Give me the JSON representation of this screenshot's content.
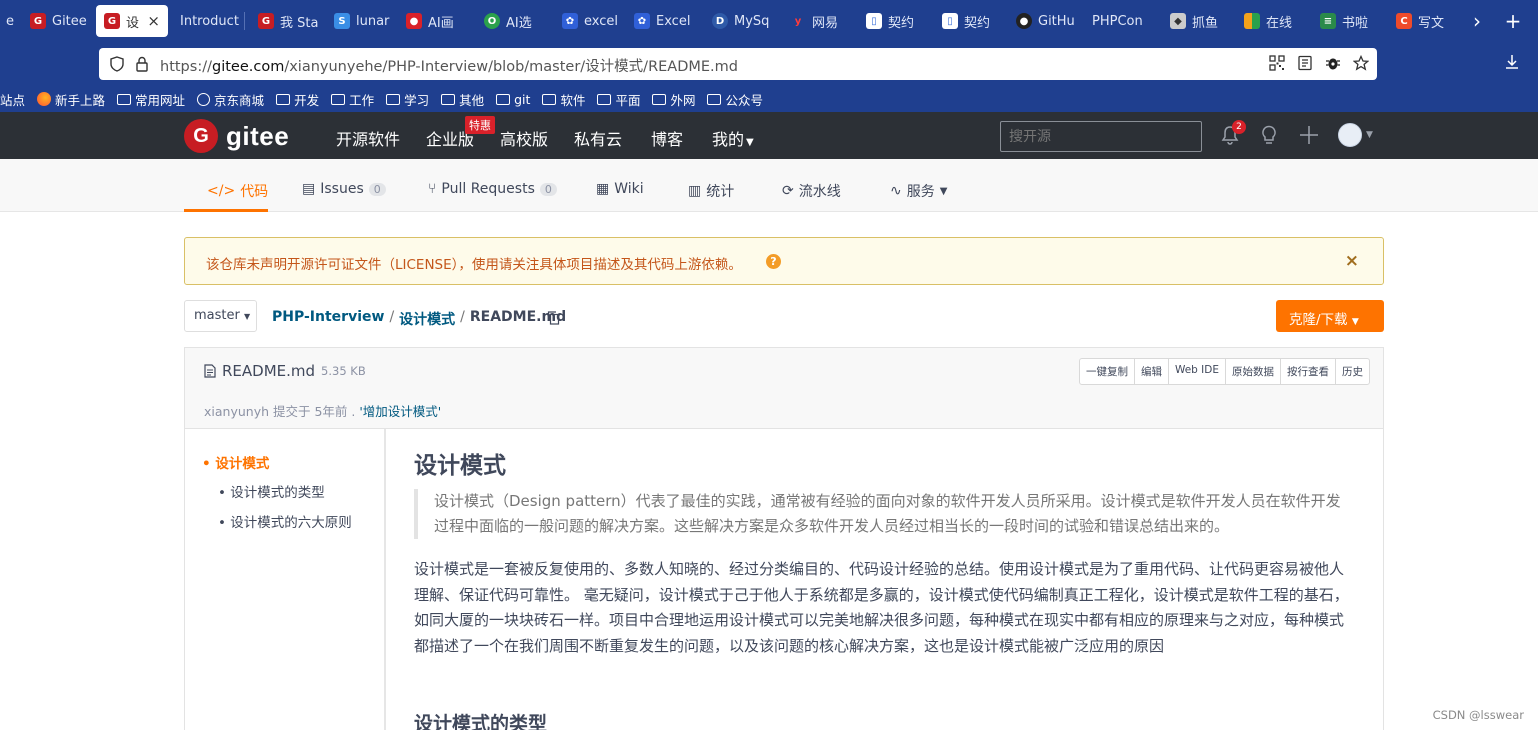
{
  "browser": {
    "tabs": [
      {
        "label": "e",
        "icon": "partial-tab",
        "color": "#1f3f8f"
      },
      {
        "label": "Gitee",
        "icon": "gitee-icon",
        "color": "#c71d23"
      },
      {
        "label": "设",
        "icon": "gitee-icon",
        "color": "#c71d23",
        "active": true
      },
      {
        "label": "Introduct",
        "icon": "none",
        "color": "#1f3f8f"
      },
      {
        "label": "我 Sta",
        "icon": "gitee-icon",
        "color": "#c71d23"
      },
      {
        "label": "lunar",
        "icon": "s-icon",
        "color": "#3a8ee6"
      },
      {
        "label": "AI画",
        "icon": "flag-icon",
        "color": "#d9212a"
      },
      {
        "label": "AI选",
        "icon": "ring-icon",
        "color": "#2ba14c"
      },
      {
        "label": "excel",
        "icon": "paw-icon",
        "color": "#3060d8"
      },
      {
        "label": "Excel",
        "icon": "paw-icon",
        "color": "#3060d8"
      },
      {
        "label": "MySq",
        "icon": "d-icon",
        "color": "#2f5aa8"
      },
      {
        "label": "网易",
        "icon": "y-icon",
        "color": "#d9212a"
      },
      {
        "label": "契约",
        "icon": "doc-icon",
        "color": "#3a6fd8"
      },
      {
        "label": "契约",
        "icon": "doc-icon",
        "color": "#3a6fd8"
      },
      {
        "label": "GitHu",
        "icon": "github-icon",
        "color": "#222222"
      },
      {
        "label": "PHPCon",
        "icon": "none",
        "color": "#1f3f8f"
      },
      {
        "label": "抓鱼",
        "icon": "duck-icon",
        "color": "#cccccc"
      },
      {
        "label": "在线",
        "icon": "grid-icon",
        "color": "#f4a21b"
      },
      {
        "label": "书啦",
        "icon": "book-icon",
        "color": "#2a8a4a"
      },
      {
        "label": "写文",
        "icon": "c-icon",
        "color": "#ee4b2b"
      }
    ],
    "url_prefix": "https://",
    "url_host": "gitee.com",
    "url_path": "/xianyunyehe/PHP-Interview/blob/master/设计模式/README.md",
    "bookmarks": [
      "站点",
      "新手上路",
      "常用网址",
      "京东商城",
      "开发",
      "工作",
      "学习",
      "其他",
      "git",
      "软件",
      "平面",
      "外网",
      "公众号"
    ]
  },
  "gitee_header": {
    "logo_text": "gitee",
    "nav": [
      "开源软件",
      "企业版",
      "高校版",
      "私有云",
      "博客",
      "我的"
    ],
    "hot_tag": "特惠",
    "search_placeholder": "搜开源",
    "notification_count": "2"
  },
  "repo_nav": {
    "tabs": [
      {
        "label": "代码",
        "count": ""
      },
      {
        "label": "Issues",
        "count": "0"
      },
      {
        "label": "Pull Requests",
        "count": "0"
      },
      {
        "label": "Wiki",
        "count": ""
      },
      {
        "label": "统计",
        "count": ""
      },
      {
        "label": "流水线",
        "count": ""
      },
      {
        "label": "服务",
        "count": ""
      }
    ]
  },
  "alert": {
    "text": "该仓库未声明开源许可证文件（LICENSE），使用请关注具体项目描述及其代码上游依赖。",
    "help": "?",
    "close": "×"
  },
  "breadcrumb": {
    "branch": "master",
    "repo": "PHP-Interview",
    "folder": "设计模式",
    "file": "README.md",
    "clone_button": "克隆/下载"
  },
  "file": {
    "name": "README.md",
    "size": "5.35 KB",
    "actions": [
      "一键复制",
      "编辑",
      "Web IDE",
      "原始数据",
      "按行查看",
      "历史"
    ],
    "commit_author": "xianyunyh",
    "commit_info": " 提交于  5年前 . ",
    "commit_message": "'增加设计模式'"
  },
  "toc": [
    {
      "label": "设计模式",
      "level": 1
    },
    {
      "label": "设计模式的类型",
      "level": 2
    },
    {
      "label": "设计模式的六大原则",
      "level": 2
    }
  ],
  "readme": {
    "title": "设计模式",
    "quote": "设计模式（Design pattern）代表了最佳的实践，通常被有经验的面向对象的软件开发人员所采用。设计模式是软件开发人员在软件开发过程中面临的一般问题的解决方案。这些解决方案是众多软件开发人员经过相当长的一段时间的试验和错误总结出来的。",
    "paragraph": "设计模式是一套被反复使用的、多数人知晓的、经过分类编目的、代码设计经验的总结。使用设计模式是为了重用代码、让代码更容易被他人理解、保证代码可靠性。 毫无疑问，设计模式于己于他人于系统都是多赢的，设计模式使代码编制真正工程化，设计模式是软件工程的基石，如同大厦的一块块砖石一样。项目中合理地运用设计模式可以完美地解决很多问题，每种模式在现实中都有相应的原理来与之对应，每种模式都描述了一个在我们周围不断重复发生的问题，以及该问题的核心解决方案，这也是设计模式能被广泛应用的原因",
    "heading2": "设计模式的类型"
  },
  "watermark": "CSDN @lsswear"
}
